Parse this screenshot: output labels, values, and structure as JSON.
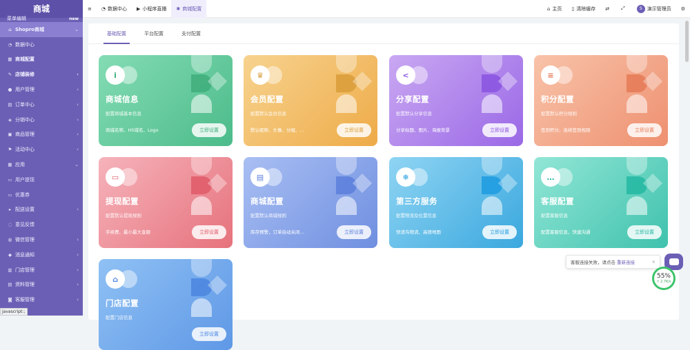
{
  "sidebar": {
    "brand": "商城",
    "partial_item": {
      "label": "菜单编辑",
      "badge": "new"
    },
    "items": [
      {
        "label": "Shopro商城",
        "icon": "home-icon",
        "chevron": "⌄",
        "group": true,
        "active": true
      },
      {
        "label": "数据中心",
        "icon": "dashboard-icon",
        "chevron": ""
      },
      {
        "label": "商城配置",
        "icon": "store-icon",
        "chevron": "",
        "group": true
      },
      {
        "label": "店铺装修",
        "icon": "brush-icon",
        "chevron": "‹",
        "group": true
      },
      {
        "label": "用户管理",
        "icon": "user-icon",
        "chevron": "‹"
      },
      {
        "label": "订单中心",
        "icon": "order-icon",
        "chevron": "‹"
      },
      {
        "label": "分销中心",
        "icon": "share-icon",
        "chevron": "‹"
      },
      {
        "label": "商品管理",
        "icon": "goods-icon",
        "chevron": "‹"
      },
      {
        "label": "活动中心",
        "icon": "flag-icon",
        "chevron": "‹"
      },
      {
        "label": "应用",
        "icon": "apps-icon",
        "chevron": "⌄"
      },
      {
        "label": "用户提现",
        "icon": "wallet-icon",
        "chevron": "",
        "sub": true
      },
      {
        "label": "优惠券",
        "icon": "coupon-icon",
        "chevron": "",
        "sub": true
      },
      {
        "label": "配送设置",
        "icon": "truck-icon",
        "chevron": "‹"
      },
      {
        "label": "意见反馈",
        "icon": "feedback-icon",
        "chevron": ""
      },
      {
        "label": "微信管理",
        "icon": "wechat-icon",
        "chevron": "‹"
      },
      {
        "label": "消息通知",
        "icon": "bell-icon",
        "chevron": "‹"
      },
      {
        "label": "门店管理",
        "icon": "shop-icon",
        "chevron": "‹"
      },
      {
        "label": "资料管理",
        "icon": "file-icon",
        "chevron": "‹"
      },
      {
        "label": "客服管理",
        "icon": "service-icon",
        "chevron": "‹"
      }
    ]
  },
  "topbar": {
    "menu_icon": "≡",
    "tabs": [
      {
        "label": "数据中心",
        "icon": "dashboard-icon"
      },
      {
        "label": "小程序直播",
        "icon": "video-icon"
      },
      {
        "label": "商城配置",
        "icon": "settings-icon",
        "active": true
      }
    ],
    "right": [
      {
        "label": "主页",
        "icon": "home-icon"
      },
      {
        "label": "清除缓存",
        "icon": "trash-icon"
      },
      {
        "label": "",
        "icon": "language-icon"
      },
      {
        "label": "",
        "icon": "fullscreen-icon"
      }
    ],
    "user": {
      "avatar_text": "S",
      "name": "演示管理员"
    },
    "settings_icon": "gear-icon"
  },
  "config_tabs": [
    "基础配置",
    "平台配置",
    "支付配置"
  ],
  "active_tab": 0,
  "cards": [
    {
      "title": "商城信息",
      "desc": "配置商城基本信息",
      "features": "商城名称、H5域名、Logo",
      "button": "立即设置",
      "icon_glyph": "i",
      "icon": "info-icon",
      "gradient": [
        "#84dcb4",
        "#4cbb8a"
      ],
      "accent": "#3fae7b"
    },
    {
      "title": "会员配置",
      "desc": "配置默认会员信息",
      "features": "默认昵称、头像、分组、...",
      "button": "立即设置",
      "icon_glyph": "♛",
      "icon": "crown-icon",
      "gradient": [
        "#f7d38f",
        "#eeab48"
      ],
      "accent": "#d99c3a"
    },
    {
      "title": "分享配置",
      "desc": "配置默认分享信息",
      "features": "分享标题、图片、海报背景",
      "button": "立即设置",
      "icon_glyph": "<",
      "icon": "share-icon",
      "gradient": [
        "#c9a8f2",
        "#9a68e6"
      ],
      "accent": "#8a53e0"
    },
    {
      "title": "积分配置",
      "desc": "配置默认积分规则",
      "features": "签到积分、连续签到规则",
      "button": "立即设置",
      "icon_glyph": "≡",
      "icon": "coins-icon",
      "gradient": [
        "#f8c3a9",
        "#ee9070"
      ],
      "accent": "#e57a56"
    },
    {
      "title": "提现配置",
      "desc": "配置默认提现规则",
      "features": "手续费、最小最大金额",
      "button": "立即设置",
      "icon_glyph": "▭",
      "icon": "wallet-icon",
      "gradient": [
        "#f6b3bb",
        "#e6727c"
      ],
      "accent": "#e05a68"
    },
    {
      "title": "商城配置",
      "desc": "配置默认商城规则",
      "features": "库存预警，订单自动关闭...",
      "button": "立即设置",
      "icon_glyph": "▤",
      "icon": "document-icon",
      "gradient": [
        "#a9bff3",
        "#6f8fe0"
      ],
      "accent": "#5c7fdc"
    },
    {
      "title": "第三方服务",
      "desc": "配置物流及位置信息",
      "features": "快递鸟物流、高德地图",
      "button": "立即设置",
      "icon_glyph": "❄",
      "icon": "service-icon",
      "gradient": [
        "#8fd4f3",
        "#3aa8de"
      ],
      "accent": "#1d9be0"
    },
    {
      "title": "客服配置",
      "desc": "配置客服信息",
      "features": "配置客服信息，快速沟通",
      "button": "立即设置",
      "icon_glyph": "…",
      "icon": "chat-icon",
      "gradient": [
        "#92e6d6",
        "#3fc2ad"
      ],
      "accent": "#23b8a2"
    },
    {
      "title": "门店配置",
      "desc": "配置门店信息",
      "features": "",
      "button": "立即设置",
      "icon_glyph": "⌂",
      "icon": "store-icon",
      "gradient": [
        "#8fc1f4",
        "#5f98e6"
      ],
      "accent": "#4b86df"
    }
  ],
  "toast": {
    "message": "客服连接失败，请点击",
    "link": "重新连接",
    "close": "×"
  },
  "meter": {
    "percent": "55%",
    "speed": "↑ 2.7K/s"
  },
  "status_text": "javascript:;"
}
